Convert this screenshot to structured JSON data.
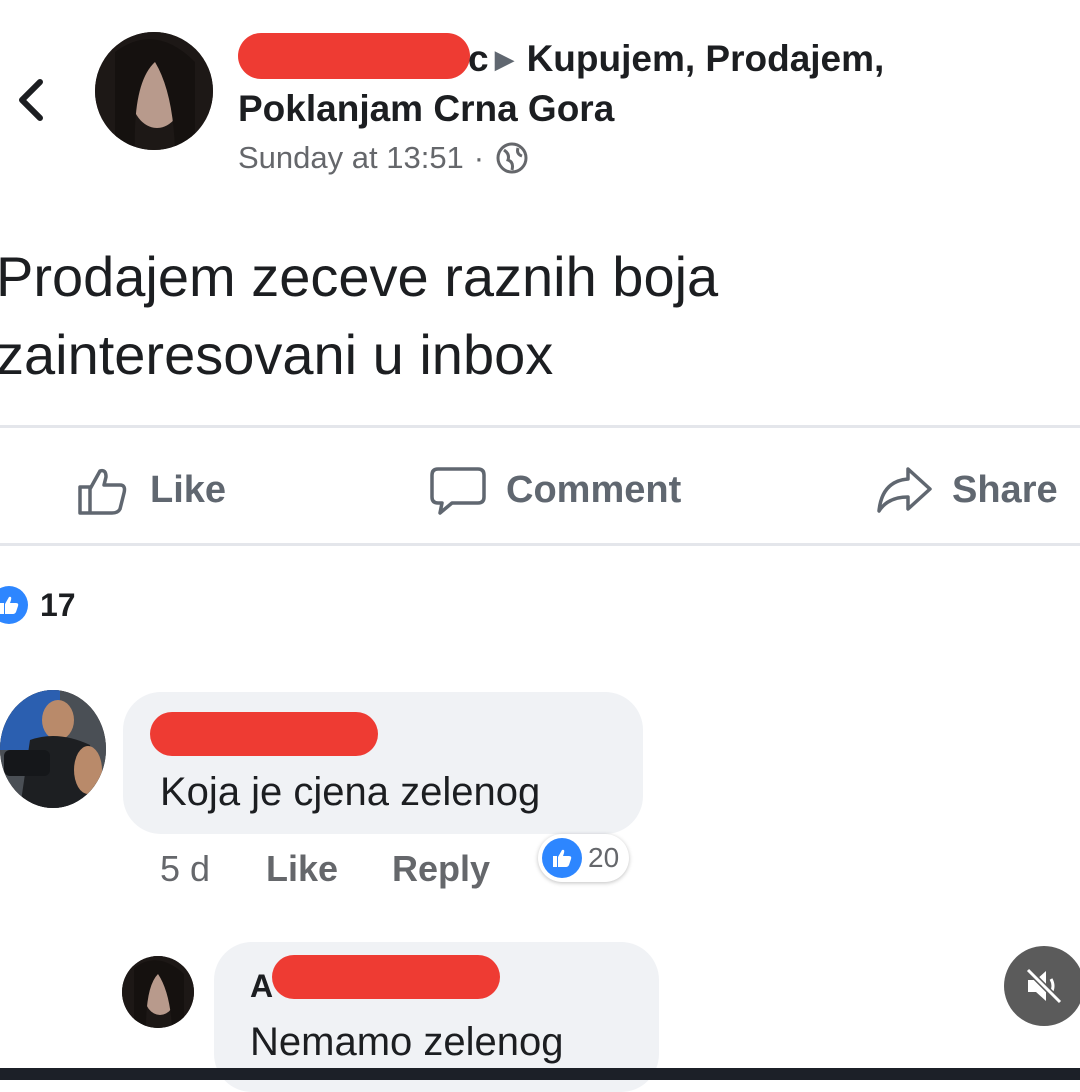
{
  "post": {
    "author_suffix": "c",
    "group": "Kupujem, Prodajem,",
    "group_line2": "Poklanjam Crna Gora",
    "timestamp": "Sunday at 13:51",
    "separator": "·",
    "privacy_icon": "globe-icon",
    "text": "Prodajem zeceve raznih boja\nzainteresovani u inbox"
  },
  "actions": {
    "like": "Like",
    "comment": "Comment",
    "share": "Share"
  },
  "reactions": {
    "count": "17"
  },
  "comments": [
    {
      "text": "Koja je cjena zelenog",
      "age": "5 d",
      "like": "Like",
      "reply": "Reply",
      "reaction_count": "20"
    },
    {
      "name_initial": "A",
      "text": "Nemamo zelenog"
    }
  ],
  "colors": {
    "accent": "#2d86ff",
    "redaction": "#ee3b33",
    "bubble": "#f0f2f5",
    "muted_text": "#65676b"
  }
}
